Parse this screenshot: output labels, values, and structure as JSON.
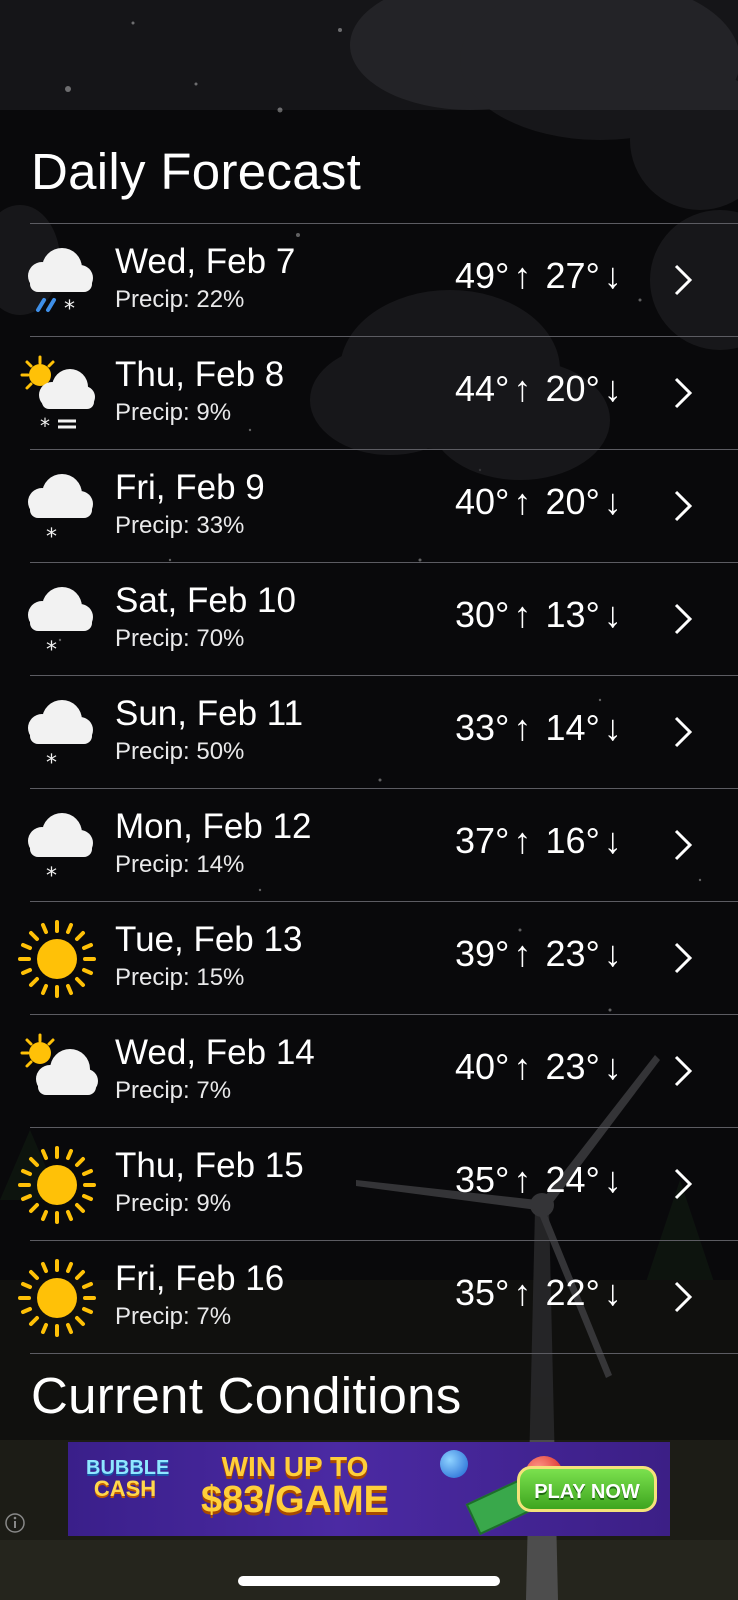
{
  "daily_forecast": {
    "title": "Daily Forecast",
    "days": [
      {
        "date": "Wed, Feb 7",
        "precip": "Precip: 22%",
        "high": "49°",
        "low": "27°",
        "icon": "cloud-rain-snow-icon"
      },
      {
        "date": "Thu, Feb 8",
        "precip": "Precip: 9%",
        "high": "44°",
        "low": "20°",
        "icon": "partly-cloudy-snow-fog-icon"
      },
      {
        "date": "Fri, Feb 9",
        "precip": "Precip: 33%",
        "high": "40°",
        "low": "20°",
        "icon": "cloud-snow-icon"
      },
      {
        "date": "Sat, Feb 10",
        "precip": "Precip: 70%",
        "high": "30°",
        "low": "13°",
        "icon": "cloud-snow-icon"
      },
      {
        "date": "Sun, Feb 11",
        "precip": "Precip: 50%",
        "high": "33°",
        "low": "14°",
        "icon": "cloud-snow-icon"
      },
      {
        "date": "Mon, Feb 12",
        "precip": "Precip: 14%",
        "high": "37°",
        "low": "16°",
        "icon": "cloud-snow-icon"
      },
      {
        "date": "Tue, Feb 13",
        "precip": "Precip: 15%",
        "high": "39°",
        "low": "23°",
        "icon": "sun-icon"
      },
      {
        "date": "Wed, Feb 14",
        "precip": "Precip: 7%",
        "high": "40°",
        "low": "23°",
        "icon": "partly-cloudy-icon"
      },
      {
        "date": "Thu, Feb 15",
        "precip": "Precip: 9%",
        "high": "35°",
        "low": "24°",
        "icon": "sun-icon"
      },
      {
        "date": "Fri, Feb 16",
        "precip": "Precip: 7%",
        "high": "35°",
        "low": "22°",
        "icon": "sun-icon"
      }
    ],
    "arrow_up": "↑",
    "arrow_down": "↓"
  },
  "current_conditions": {
    "title": "Current Conditions"
  },
  "ad": {
    "logo_line1": "BUBBLE",
    "logo_line2": "CASH",
    "headline_line1": "WIN UP TO",
    "headline_line2": "$83/GAME",
    "cta": "PLAY NOW"
  },
  "colors": {
    "sun": "#ffc107",
    "cloud": "#f2f2f2",
    "rain": "#3f8fe8",
    "divider": "#5c5c62"
  }
}
